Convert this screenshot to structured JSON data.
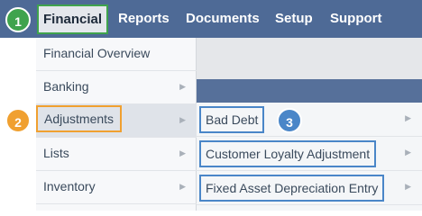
{
  "topnav": {
    "items": [
      "Financial",
      "Reports",
      "Documents",
      "Setup",
      "Support"
    ]
  },
  "menu1": {
    "items": [
      "Financial Overview",
      "Banking",
      "Adjustments",
      "Lists",
      "Inventory"
    ]
  },
  "menu2": {
    "items": [
      "Bad Debt",
      "Customer Loyalty Adjustment",
      "Fixed Asset Depreciation Entry"
    ]
  },
  "badges": {
    "step1": "1",
    "step2": "2",
    "step3": "3"
  },
  "colors": {
    "topbar": "#4e6a96",
    "step1": "#3fa34d",
    "step2": "#f0a030",
    "step3": "#4a86c8"
  },
  "icons": {
    "submenu_arrow": "▶"
  }
}
